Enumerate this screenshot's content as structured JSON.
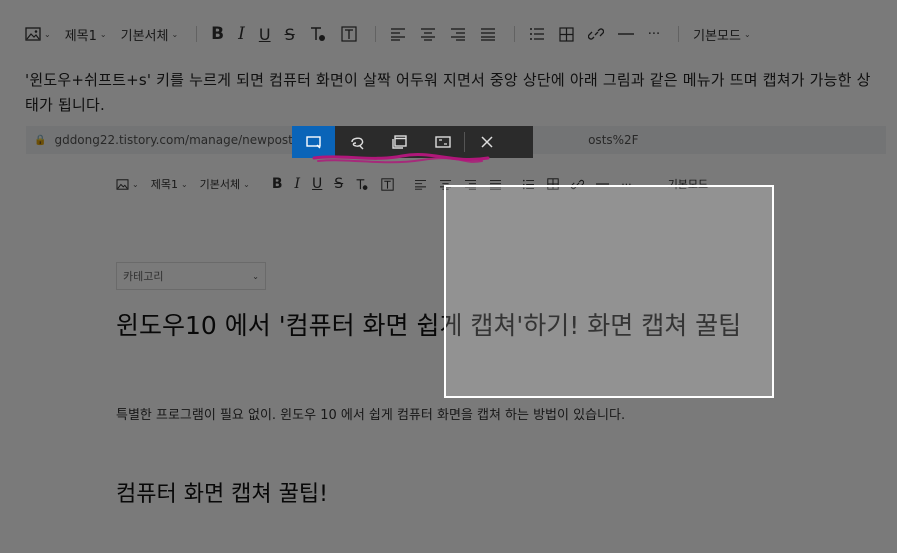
{
  "editor_toolbar": {
    "heading": "제목1",
    "font": "기본서체",
    "mode": "기본모드",
    "more": "···"
  },
  "paragraph": "'윈도우+쉬프트+s' 키를 누르게 되면 컴퓨터 화면이 살짝 어두워 지면서 중앙 상단에 아래 그림과 같은 메뉴가 뜨며 캡쳐가 가능한 상태가 됩니다.",
  "screenshot": {
    "url": "gddong22.tistory.com/manage/newpost/?type",
    "url_suffix": "osts%2F",
    "toolbar": {
      "heading": "제목1",
      "font": "기본서체",
      "mode": "기본모드",
      "more": "···"
    },
    "category": "카테고리",
    "title": "윈도우10 에서 '컴퓨터 화면 쉽게 캡쳐'하기!  화면 캡쳐 꿀팁",
    "body": "특별한 프로그램이 필요 없이. 윈도우 10 에서 쉽게 컴퓨터 화면을 캡쳐 하는 방법이 있습니다.",
    "heading2": "컴퓨터 화면 캡쳐 꿀팁!"
  },
  "snip_toolbar": {
    "buttons": [
      "rectangle-snip",
      "freeform-snip",
      "window-snip",
      "fullscreen-snip",
      "close"
    ],
    "active": "rectangle-snip",
    "accent": "#0a64b8"
  },
  "colors": {
    "overlay": "#000000",
    "selection_border": "#ffffff",
    "scribble": "#b0177a"
  }
}
